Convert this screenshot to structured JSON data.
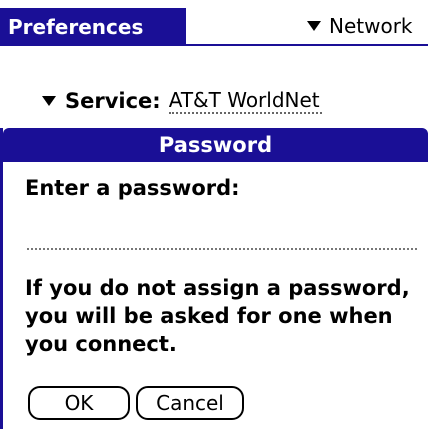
{
  "header": {
    "title": "Preferences",
    "category": "Network"
  },
  "service": {
    "label": "Service:",
    "value": "AT&T WorldNet"
  },
  "dialog": {
    "title": "Password",
    "prompt": "Enter a password:",
    "password_value": "",
    "message": "If you do not assign a password, you will be asked for one when you connect.",
    "ok_label": "OK",
    "cancel_label": "Cancel"
  },
  "colors": {
    "title_bar": "#1a0f96",
    "background": "#ffffff",
    "text": "#000000"
  },
  "icons": {
    "category_picker": "triangle-down-icon",
    "service_picker": "triangle-down-icon"
  }
}
